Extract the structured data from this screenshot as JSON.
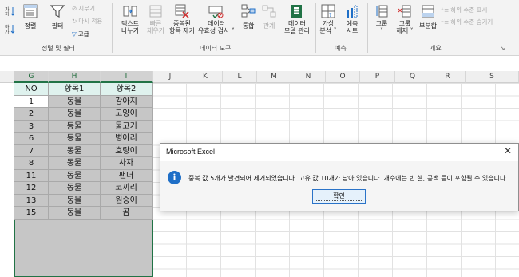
{
  "ribbon": {
    "sort_filter": {
      "sort_label": "정렬",
      "filter_label": "필터",
      "clear_label": "지우기",
      "reapply_label": "다시 적용",
      "advanced_label": "고급",
      "group_label": "정렬 및 필터"
    },
    "data_tools": {
      "text_to_columns_label1": "텍스트",
      "text_to_columns_label2": "나누기",
      "flash_fill_label1": "빠른",
      "flash_fill_label2": "채우기",
      "remove_dup_label1": "중복된",
      "remove_dup_label2": "항목 제거",
      "validation_label1": "데이터",
      "validation_label2": "유효성 검사 ˅",
      "consolidate_label": "통합",
      "relationships_label": "관계",
      "data_model_label1": "데이터",
      "data_model_label2": "모델 관리",
      "group_label": "데이터 도구"
    },
    "forecast": {
      "whatif_label1": "가상",
      "whatif_label2": "분석 ˅",
      "sheet_label1": "예측",
      "sheet_label2": "시트",
      "group_label": "예측"
    },
    "outline": {
      "group_btn_label1": "그룹",
      "group_btn_label2": "˅",
      "ungroup_label1": "그룹",
      "ungroup_label2": "해제 ˅",
      "subtotal_label": "부분합",
      "show_detail_label": "하위 수준 표시",
      "hide_detail_label": "하위 수준 숨기기",
      "group_label": "개요"
    }
  },
  "sheet": {
    "columns": [
      "G",
      "H",
      "I",
      "J",
      "K",
      "L",
      "M",
      "N",
      "O",
      "P",
      "Q",
      "R",
      "S"
    ],
    "table_headers": [
      "NO",
      "항목1",
      "항목2"
    ],
    "rows": [
      [
        "1",
        "동물",
        "강아지"
      ],
      [
        "2",
        "동물",
        "고양이"
      ],
      [
        "3",
        "동물",
        "물고기"
      ],
      [
        "6",
        "동물",
        "병아리"
      ],
      [
        "7",
        "동물",
        "호랑이"
      ],
      [
        "8",
        "동물",
        "사자"
      ],
      [
        "11",
        "동물",
        "팬더"
      ],
      [
        "12",
        "동물",
        "코끼리"
      ],
      [
        "13",
        "동물",
        "원숭이"
      ],
      [
        "15",
        "동물",
        "곰"
      ]
    ]
  },
  "dialog": {
    "title": "Microsoft Excel",
    "message": "중복 값 5개가 발견되어 제거되었습니다. 고유 값 10개가 남아 있습니다. 개수에는 빈 셀, 공백 등이 포함될 수 있습니다.",
    "ok_label": "확인",
    "close_glyph": "✕"
  },
  "colors": {
    "accent_green": "#217346",
    "info_blue": "#1f6fc7",
    "header_fill": "#dff2ee",
    "selection_grey": "#c6c6c6"
  }
}
